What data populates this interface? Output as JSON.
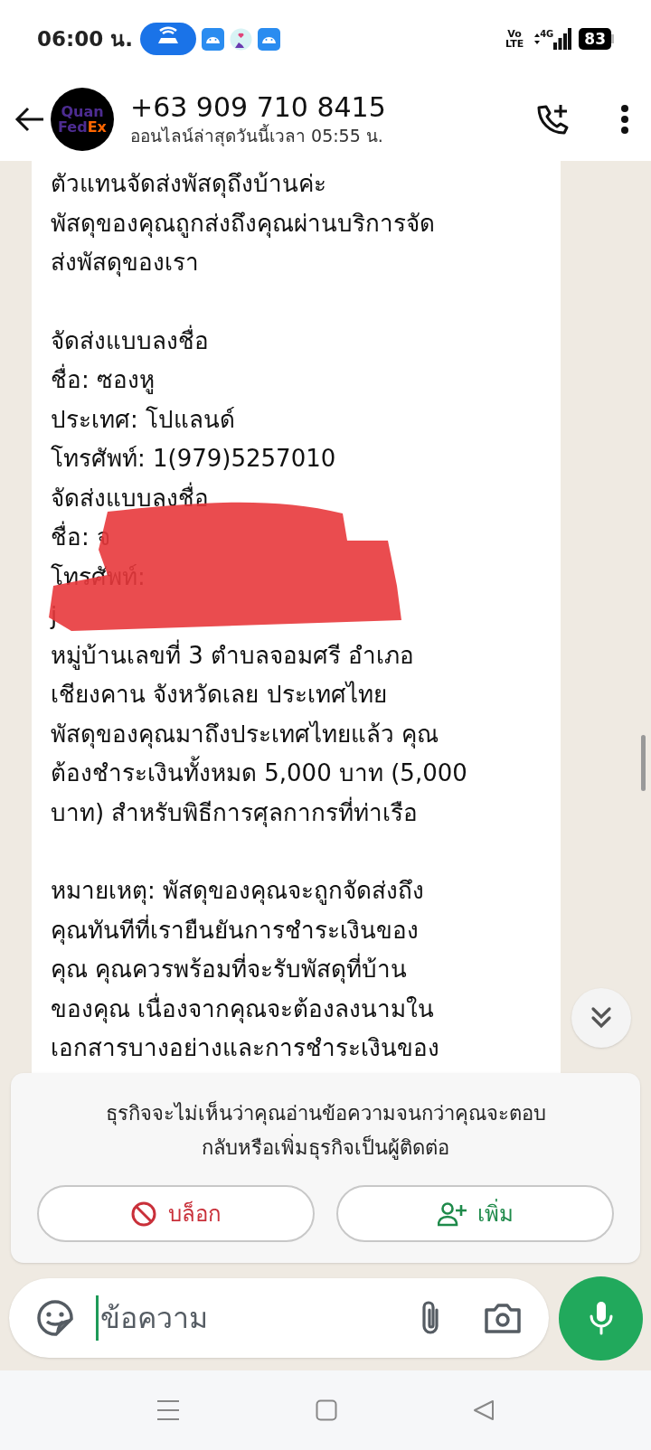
{
  "status_bar": {
    "time": "06:00 น.",
    "network": "4G",
    "volte": "Vo\nLTE",
    "battery": "83"
  },
  "header": {
    "avatar": {
      "line_1": "Quan",
      "line_2a": "Fed",
      "line_2b": "Ex"
    },
    "title": "+63 909 710 8415",
    "subtitle": "ออนไลน์ล่าสุดวันนี้เวลา 05:55 น."
  },
  "message": {
    "paragraphs": [
      [
        "ตัวแทนจัดส่งพัสดุถึงบ้านค่ะ",
        "พัสดุของคุณถูกส่งถึงคุณผ่านบริการจัด",
        "ส่งพัสดุของเรา"
      ],
      [
        "จัดส่งแบบลงชื่อ",
        "ชื่อ: ซองหู",
        "ประเทศ: โปแลนด์",
        "โทรศัพท์: 1(979)5257010",
        "จัดส่งแบบลงชื่อ",
        "ชื่อ: จ",
        "โทรศัพท์:",
        "j",
        "หมู่บ้านเลขที่ 3 ตำบลจอมศรี อำเภอ",
        "เชียงคาน จังหวัดเลย ประเทศไทย",
        "พัสดุของคุณมาถึงประเทศไทยแล้ว คุณ",
        "ต้องชำระเงินทั้งหมด 5,000 บาท (5,000",
        "บาท) สำหรับพิธีการศุลกากรที่ท่าเรือ"
      ],
      [
        "หมายเหตุ: พัสดุของคุณจะถูกจัดส่งถึง",
        "คุณทันทีที่เรายืนยันการชำระเงินของ",
        "คุณ คุณควรพร้อมที่จะรับพัสดุที่บ้าน",
        "ของคุณ เนื่องจากคุณจะต้องลงนามใน",
        "เอกสารบางอย่างและการชำระเงินของ"
      ]
    ]
  },
  "notice": {
    "text_lines": [
      "ธุรกิจจะไม่เห็นว่าคุณอ่านข้อความจนกว่าคุณจะตอบ",
      "กลับหรือเพิ่มธุรกิจเป็นผู้ติดต่อ"
    ],
    "buttons": [
      {
        "kind": "block",
        "label": "บล็อก"
      },
      {
        "kind": "add",
        "label": "เพิ่ม"
      }
    ]
  },
  "composer": {
    "placeholder": "ข้อความ"
  }
}
